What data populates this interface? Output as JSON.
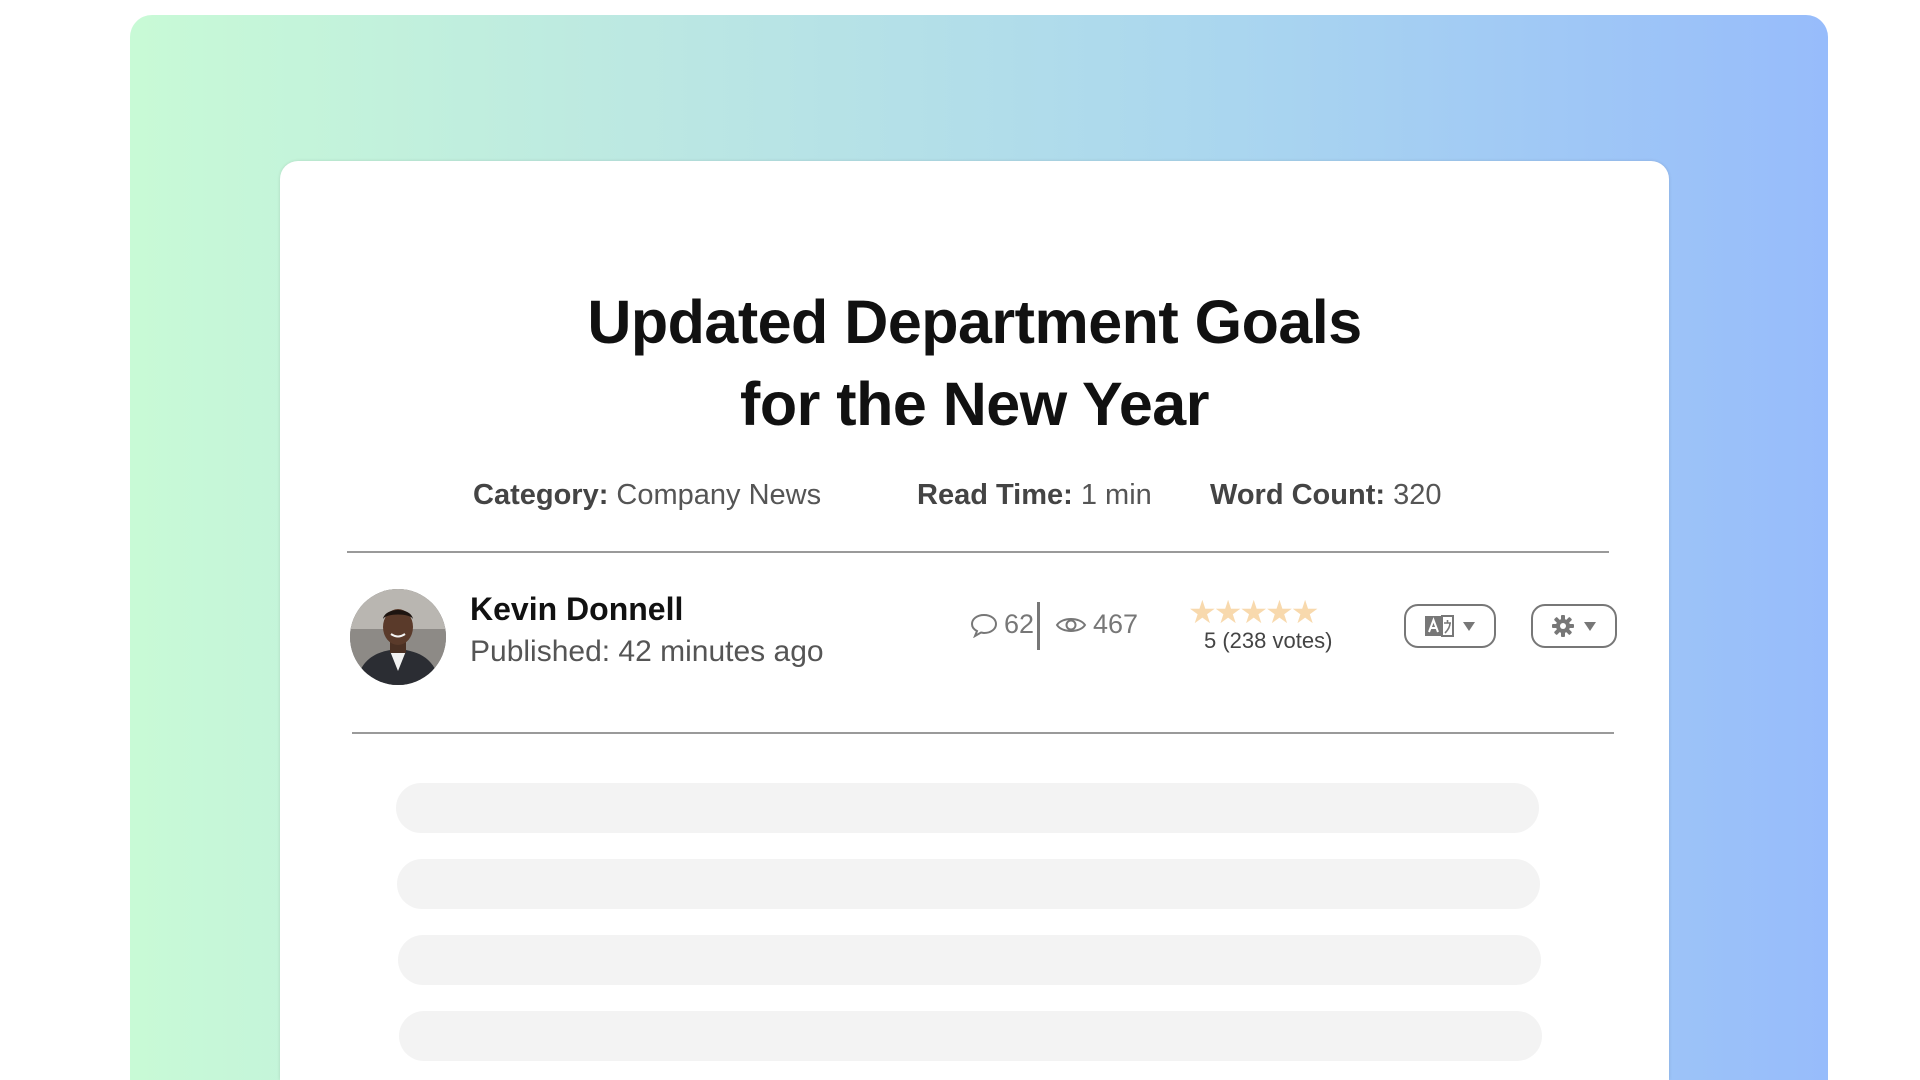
{
  "article": {
    "title_line1": "Updated Department Goals",
    "title_line2": "for the New Year"
  },
  "meta": {
    "category_label": "Category:",
    "category_value": "Company News",
    "read_time_label": "Read Time:",
    "read_time_value": "1 min",
    "word_count_label": "Word Count:",
    "word_count_value": "320"
  },
  "author": {
    "name": "Kevin Donnell",
    "published": "Published: 42 minutes ago"
  },
  "stats": {
    "comments": "62",
    "views": "467"
  },
  "rating": {
    "stars": "★★★★★",
    "value": 5,
    "votes_text": "5 (238 votes)"
  },
  "controls": {
    "translate_icon": "translate-icon",
    "settings_icon": "gear-icon",
    "dropdown_icon": "caret-down-icon"
  },
  "colors": {
    "gradient_start": "#c8fad6",
    "gradient_end": "#97bcfb",
    "star_color": "#f8d9ad"
  }
}
